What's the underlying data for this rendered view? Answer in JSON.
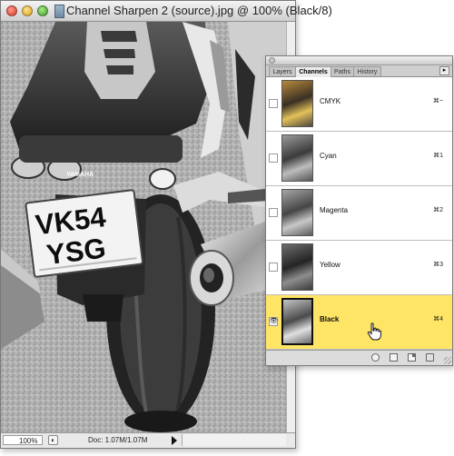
{
  "document": {
    "title": "Channel Sharpen 2 (source).jpg @ 100% (Black/8)",
    "photo": {
      "plate_line1": "VK54",
      "plate_line2": "YSG",
      "brand": "YAMAHA"
    }
  },
  "status": {
    "zoom": "100%",
    "doc_size": "Doc: 1.07M/1.07M"
  },
  "palette": {
    "tabs": [
      {
        "label": "Layers"
      },
      {
        "label": "Channels"
      },
      {
        "label": "Paths"
      },
      {
        "label": "History"
      }
    ],
    "active_tab": "Channels",
    "menu_icon": "palette-menu-icon",
    "channels": [
      {
        "name": "CMYK",
        "shortcut": "⌘~",
        "visible": false
      },
      {
        "name": "Cyan",
        "shortcut": "⌘1",
        "visible": false
      },
      {
        "name": "Magenta",
        "shortcut": "⌘2",
        "visible": false
      },
      {
        "name": "Yellow",
        "shortcut": "⌘3",
        "visible": false
      },
      {
        "name": "Black",
        "shortcut": "⌘4",
        "visible": true,
        "selected": true
      }
    ],
    "bottom_buttons": [
      "load-selection-icon",
      "save-selection-icon",
      "new-channel-icon",
      "delete-channel-icon"
    ]
  },
  "colors": {
    "selected_row": "#ffe565",
    "window_chrome": "#d8d8d8"
  }
}
